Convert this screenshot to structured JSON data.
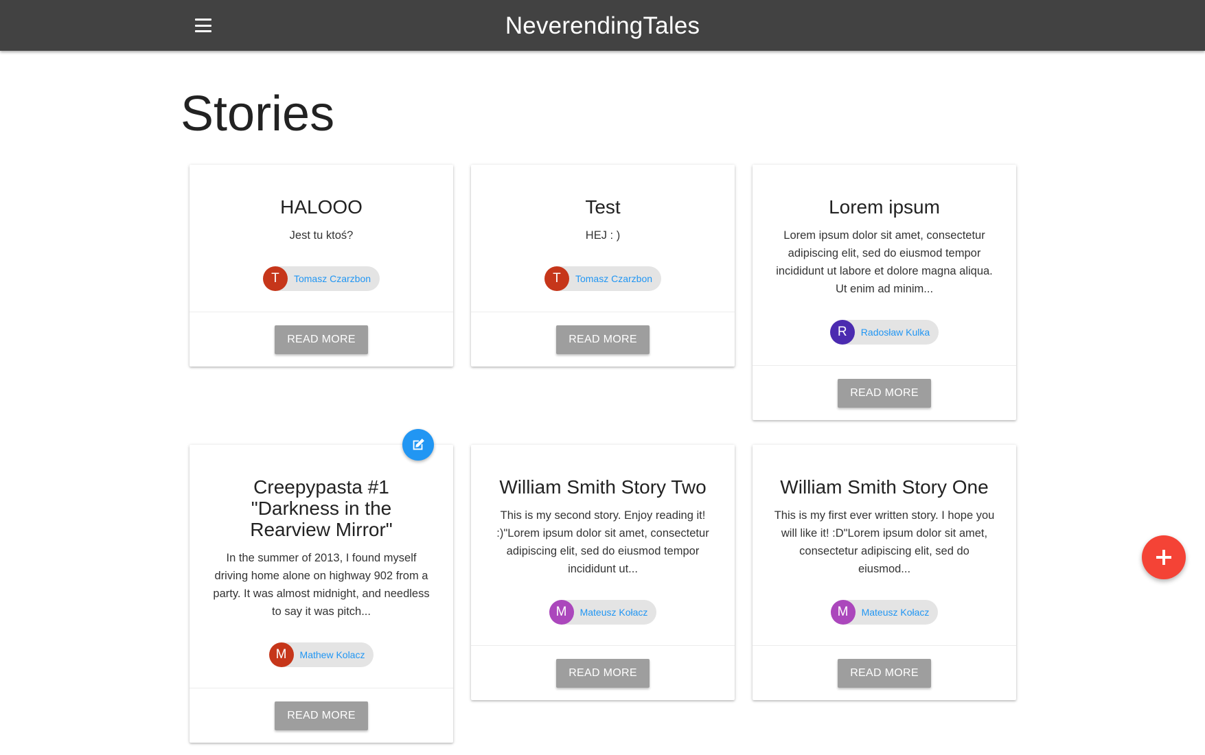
{
  "app": {
    "title": "NeverendingTales"
  },
  "page": {
    "title": "Stories"
  },
  "colors": {
    "appbar": "#424242",
    "accent_blue": "#2196f3",
    "fab_red": "#f44336",
    "button_grey": "#9e9e9e"
  },
  "icons": {
    "menu": "menu-icon",
    "edit": "edit-icon",
    "add": "plus-icon"
  },
  "stories": [
    {
      "title": "HALOOO",
      "excerpt": "Jest tu ktoś?",
      "author_initial": "T",
      "author": "Tomasz Czarzbon",
      "avatar_color": "#c6361a",
      "button": "READ MORE"
    },
    {
      "title": "Test",
      "excerpt": "HEJ : )",
      "author_initial": "T",
      "author": "Tomasz Czarzbon",
      "avatar_color": "#c6361a",
      "button": "READ MORE"
    },
    {
      "title": "Lorem ipsum",
      "excerpt": "Lorem ipsum dolor sit amet, consectetur adipiscing elit, sed do eiusmod tempor incididunt ut labore et dolore magna aliqua. Ut enim ad minim...",
      "author_initial": "R",
      "author": "Radosław Kulka",
      "avatar_color": "#4b2bb0",
      "button": "READ MORE"
    },
    {
      "title": "Creepypasta #1 \"Darkness in the Rearview Mirror\"",
      "excerpt": "In the summer of 2013, I found myself driving home alone on highway 902 from a party. It was almost midnight, and needless to say it was pitch...",
      "author_initial": "M",
      "author": "Mathew Kolacz",
      "avatar_color": "#c6361a",
      "button": "READ MORE"
    },
    {
      "title": "William Smith Story Two",
      "excerpt": "This is my second story. Enjoy reading it! :)\"Lorem ipsum dolor sit amet, consectetur adipiscing elit, sed do eiusmod tempor incididunt ut...",
      "author_initial": "M",
      "author": "Mateusz Kołacz",
      "avatar_color": "#ab47bc",
      "button": "READ MORE"
    },
    {
      "title": "William Smith Story One",
      "excerpt": "This is my first ever written story. I hope you will like it! :D\"Lorem ipsum dolor sit amet, consectetur adipiscing elit, sed do eiusmod...",
      "author_initial": "M",
      "author": "Mateusz Kołacz",
      "avatar_color": "#ab47bc",
      "button": "READ MORE"
    }
  ]
}
